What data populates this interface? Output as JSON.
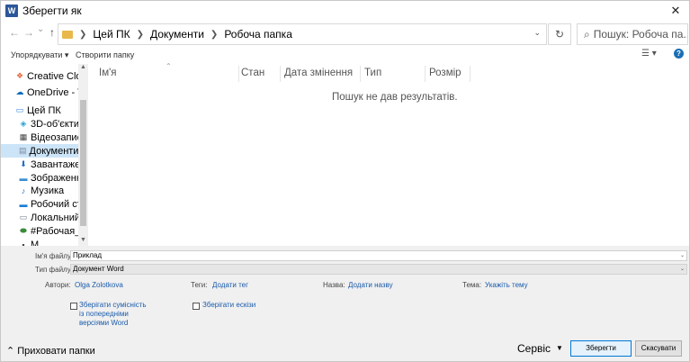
{
  "window": {
    "title": "Зберегти як",
    "app_icon": "W",
    "close_glyph": "✕"
  },
  "nav": {
    "back_glyph": "←",
    "forward_glyph": "→",
    "recent_glyph": "⌄",
    "up_glyph": "↑",
    "breadcrumb": [
      "Цей ПК",
      "Документи",
      "Робоча папка"
    ],
    "refresh_glyph": "↻",
    "search_placeholder": "Пошук: Робоча па..."
  },
  "toolbar": {
    "organize": "Упорядкувати ▾",
    "new_folder": "Створити папку",
    "view_glyph": "☰ ▾",
    "help_glyph": "?"
  },
  "sidebar": {
    "items": [
      {
        "label": "Creative Clo",
        "icon": "creative-cloud-icon",
        "glyph": "❖",
        "color": "#e8663b",
        "selected": false
      },
      {
        "label": "OneDrive - T",
        "icon": "onedrive-icon",
        "glyph": "☁",
        "color": "#0f6cbd",
        "selected": false
      },
      {
        "label": "Цей ПК",
        "icon": "this-pc-icon",
        "glyph": "▭",
        "color": "#2a7fd4",
        "selected": false
      },
      {
        "label": "3D-об'єкти",
        "icon": "3d-objects-icon",
        "glyph": "◈",
        "color": "#2aa3d8",
        "selected": false
      },
      {
        "label": "Відеозапис",
        "icon": "video-icon",
        "glyph": "▦",
        "color": "#444444",
        "selected": false
      },
      {
        "label": "Документи",
        "icon": "documents-icon",
        "glyph": "▤",
        "color": "#7a8aa0",
        "selected": true
      },
      {
        "label": "Завантаже",
        "icon": "downloads-icon",
        "glyph": "⬇",
        "color": "#1f6fc4",
        "selected": false
      },
      {
        "label": "Зображенн",
        "icon": "pictures-icon",
        "glyph": "▬",
        "color": "#3d8fd1",
        "selected": false
      },
      {
        "label": "Музика",
        "icon": "music-icon",
        "glyph": "♪",
        "color": "#1f6fc4",
        "selected": false
      },
      {
        "label": "Робочий ст",
        "icon": "desktop-icon",
        "glyph": "▬",
        "color": "#1f7fd8",
        "selected": false
      },
      {
        "label": "Локальний",
        "icon": "local-disk-icon",
        "glyph": "▭",
        "color": "#6f7a86",
        "selected": false
      },
      {
        "label": "#Рабочая_",
        "icon": "network-drive-icon",
        "glyph": "⬬",
        "color": "#3c8c3c",
        "selected": false
      },
      {
        "label": "M",
        "icon": "network-icon",
        "glyph": "▪",
        "color": "#444444",
        "selected": false
      }
    ]
  },
  "file_list": {
    "columns": [
      "Ім'я",
      "Стан",
      "Дата змінення",
      "Тип",
      "Розмір"
    ],
    "empty_text": "Пошук не дав результатів."
  },
  "form": {
    "filename_label": "Ім'я файлу:",
    "filename_value": "Приклад",
    "filetype_label": "Тип файлу:",
    "filetype_value": "Документ Word",
    "authors_label": "Автори:",
    "authors_value": "Olga Zolotkova",
    "tags_label": "Теги:",
    "tags_value": "Додати тег",
    "title_label": "Назва:",
    "title_value": "Додати назву",
    "subject_label": "Тема:",
    "subject_value": "Укажіть тему",
    "compat_line1": "Зберігати сумісність",
    "compat_line2": "із попередніми",
    "compat_line3": "версіями Word",
    "thumbnails_label": "Зберігати ескізи"
  },
  "footer": {
    "hide_folders": "⌃ Приховати папки",
    "service": "Сервіс",
    "service_arrow": "▼",
    "save": "Зберегти",
    "cancel": "Скасувати"
  }
}
